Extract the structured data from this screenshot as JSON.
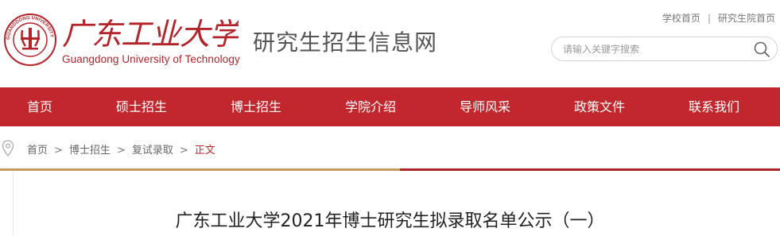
{
  "header": {
    "logo_en": "Guangdong University of Technology",
    "logo_cn": "广东工业大学",
    "seal_text": "GUANGDONG UNIVERSITY OF TECHNOLOGY",
    "site_title": "研究生招生信息网",
    "top_links": [
      "学校首页",
      "研究生院首页"
    ],
    "top_links_separator": "|"
  },
  "search": {
    "placeholder": "请输入关键字搜索",
    "value": ""
  },
  "nav": {
    "items": [
      "首页",
      "硕士招生",
      "博士招生",
      "学院介绍",
      "导师风采",
      "政策文件",
      "联系我们"
    ]
  },
  "breadcrumb": {
    "items": [
      "首页",
      "博士招生",
      "复试录取"
    ],
    "separator": ">",
    "current": "正文"
  },
  "article": {
    "title": "广东工业大学2021年博士研究生拟录取名单公示（一）"
  },
  "colors": {
    "brand_red": "#c1272d",
    "divider_gold": "#c59a5a",
    "text_gray": "#555555"
  },
  "icons": {
    "search": "search-icon",
    "location": "location-pin-icon",
    "logo": "university-seal-logo"
  }
}
